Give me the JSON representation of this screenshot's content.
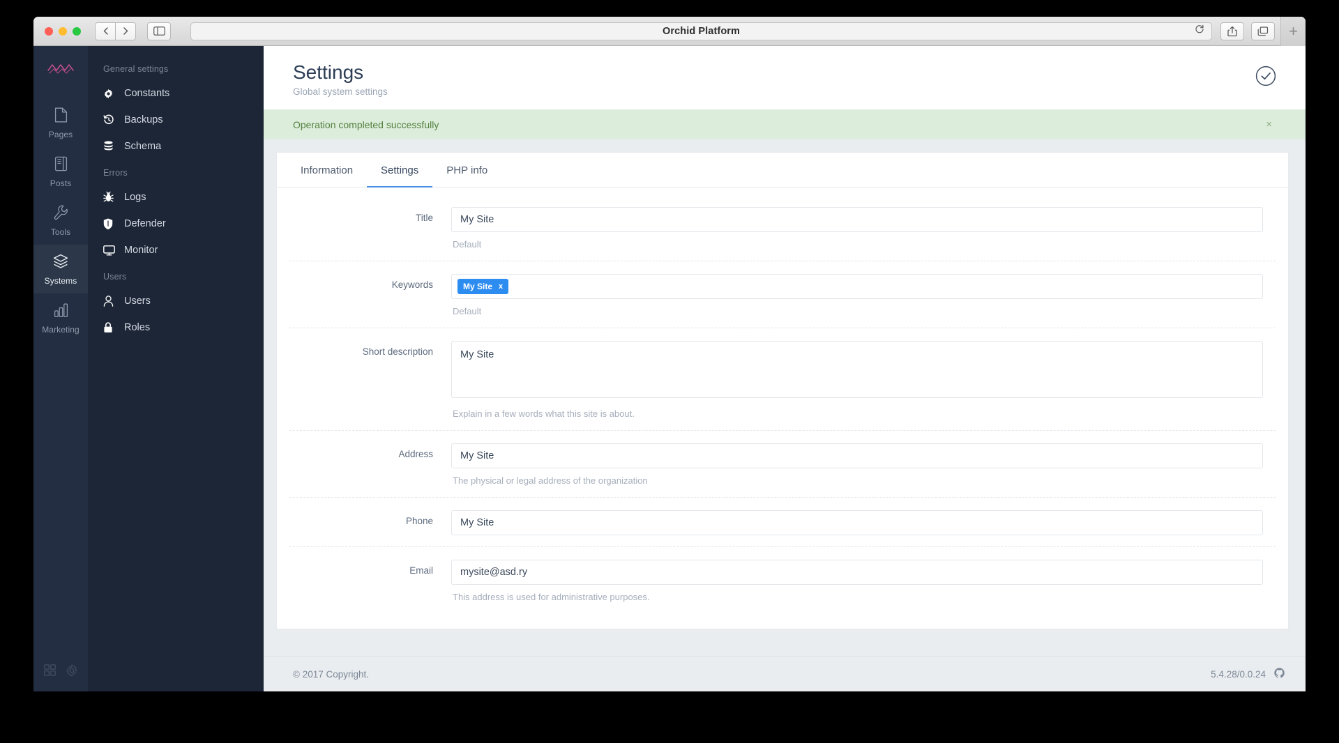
{
  "browser": {
    "title": "Orchid Platform",
    "back_label": "‹",
    "forward_label": "›",
    "new_tab_label": "+",
    "icons": {
      "sidebar": "sidebar-toggle-icon",
      "reload": "reload-icon",
      "share": "share-icon",
      "tabs": "tab-overview-icon"
    }
  },
  "rail": {
    "brand": "orchid-logo",
    "items": [
      {
        "label": "Pages",
        "icon": "page-icon",
        "active": false
      },
      {
        "label": "Posts",
        "icon": "book-icon",
        "active": false
      },
      {
        "label": "Tools",
        "icon": "wrench-icon",
        "active": false
      },
      {
        "label": "Systems",
        "icon": "layers-icon",
        "active": true
      },
      {
        "label": "Marketing",
        "icon": "bar-chart-icon",
        "active": false
      }
    ],
    "bottom": [
      {
        "icon": "grid-icon"
      },
      {
        "icon": "gear-icon"
      }
    ]
  },
  "menu": {
    "groups": [
      {
        "title": "General settings",
        "items": [
          {
            "label": "Constants",
            "icon": "gear-icon"
          },
          {
            "label": "Backups",
            "icon": "history-icon"
          },
          {
            "label": "Schema",
            "icon": "database-icon"
          }
        ]
      },
      {
        "title": "Errors",
        "items": [
          {
            "label": "Logs",
            "icon": "bug-icon"
          },
          {
            "label": "Defender",
            "icon": "shield-icon"
          },
          {
            "label": "Monitor",
            "icon": "monitor-icon"
          }
        ]
      },
      {
        "title": "Users",
        "items": [
          {
            "label": "Users",
            "icon": "user-icon"
          },
          {
            "label": "Roles",
            "icon": "lock-icon"
          }
        ]
      }
    ]
  },
  "header": {
    "title": "Settings",
    "subtitle": "Global system settings",
    "action_icon": "check-circle-icon"
  },
  "alert": {
    "message": "Operation completed successfully",
    "close_label": "×",
    "background": "#dceddb",
    "text_color": "#53803f"
  },
  "tabs": [
    {
      "label": "Information",
      "active": false
    },
    {
      "label": "Settings",
      "active": true
    },
    {
      "label": "PHP info",
      "active": false
    }
  ],
  "form": {
    "fields": [
      {
        "label": "Title",
        "type": "text",
        "value": "My Site",
        "placeholder": "",
        "help": "Default"
      },
      {
        "label": "Keywords",
        "type": "tags",
        "tags": [
          {
            "text": "My Site",
            "remove_label": "x"
          }
        ],
        "help": "Default"
      },
      {
        "label": "Short description",
        "type": "textarea",
        "value": "My Site",
        "placeholder": "",
        "help": "Explain in a few words what this site is about."
      },
      {
        "label": "Address",
        "type": "text",
        "value": "My Site",
        "placeholder": "",
        "help": "The physical or legal address of the organization"
      },
      {
        "label": "Phone",
        "type": "text",
        "value": "My Site",
        "placeholder": "",
        "help": ""
      },
      {
        "label": "Email",
        "type": "text",
        "value": "mysite@asd.ry",
        "placeholder": "",
        "help": "This address is used for administrative purposes."
      }
    ]
  },
  "footer": {
    "copyright": "© 2017 Copyright.",
    "version": "5.4.28/0.0.24",
    "icon": "github-icon"
  },
  "colors": {
    "accent_blue": "#2d8cf0",
    "rail_bg": "#242e42",
    "menu_bg": "#1d2636",
    "tab_active": "#4a90e2"
  }
}
